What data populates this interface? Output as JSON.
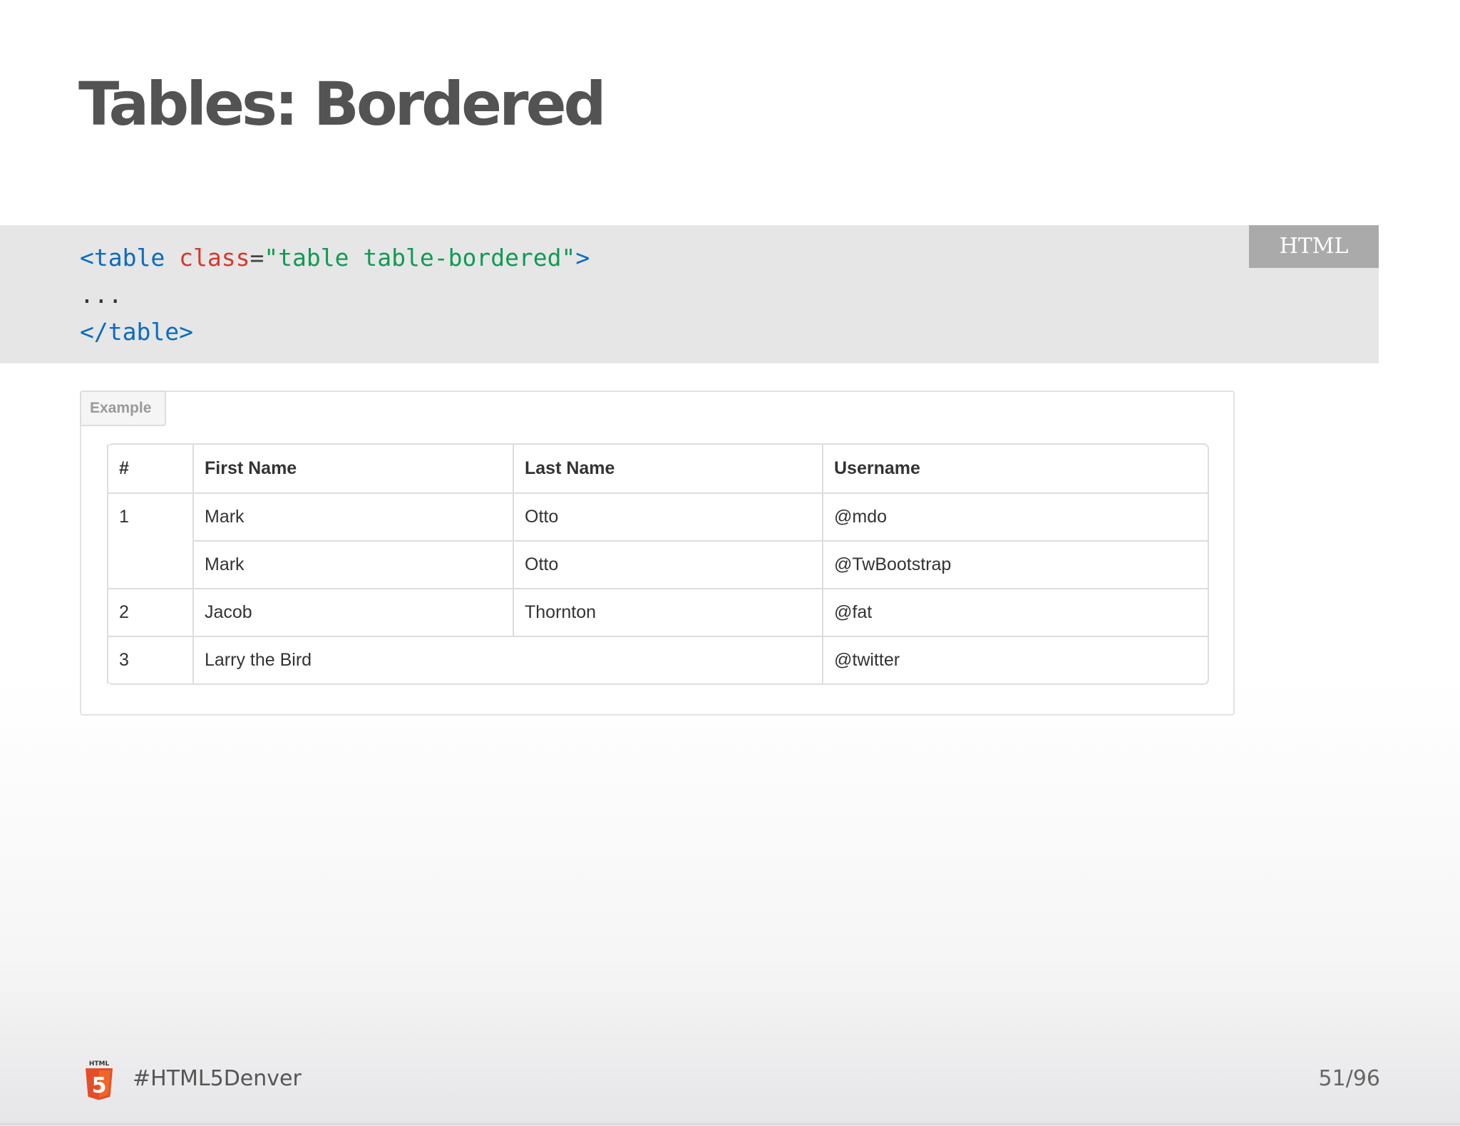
{
  "slide": {
    "title": "Tables: Bordered"
  },
  "code": {
    "language": "HTML",
    "line1": {
      "open": "<table",
      "attr": "class",
      "eq": "=",
      "value": "\"table table-bordered\"",
      "close": ">"
    },
    "line2": "...",
    "line3": "</table>"
  },
  "example": {
    "label": "Example",
    "headers": [
      "#",
      "First Name",
      "Last Name",
      "Username"
    ],
    "rows": [
      {
        "num": "1",
        "first": "Mark",
        "last": "Otto",
        "username": "@mdo"
      },
      {
        "first": "Mark",
        "last": "Otto",
        "username": "@TwBootstrap"
      },
      {
        "num": "2",
        "first": "Jacob",
        "last": "Thornton",
        "username": "@fat"
      },
      {
        "num": "3",
        "name_merged": "Larry the Bird",
        "username": "@twitter"
      }
    ]
  },
  "footer": {
    "logo_icon": "html5-logo-icon",
    "logo_text": "HTML",
    "logo_number": "5",
    "hashtag": "#HTML5Denver",
    "page": "51/96"
  },
  "colors": {
    "tag": "#0a6bbf",
    "attr": "#d7382b",
    "string": "#109a53",
    "html5_orange": "#e44d26"
  }
}
